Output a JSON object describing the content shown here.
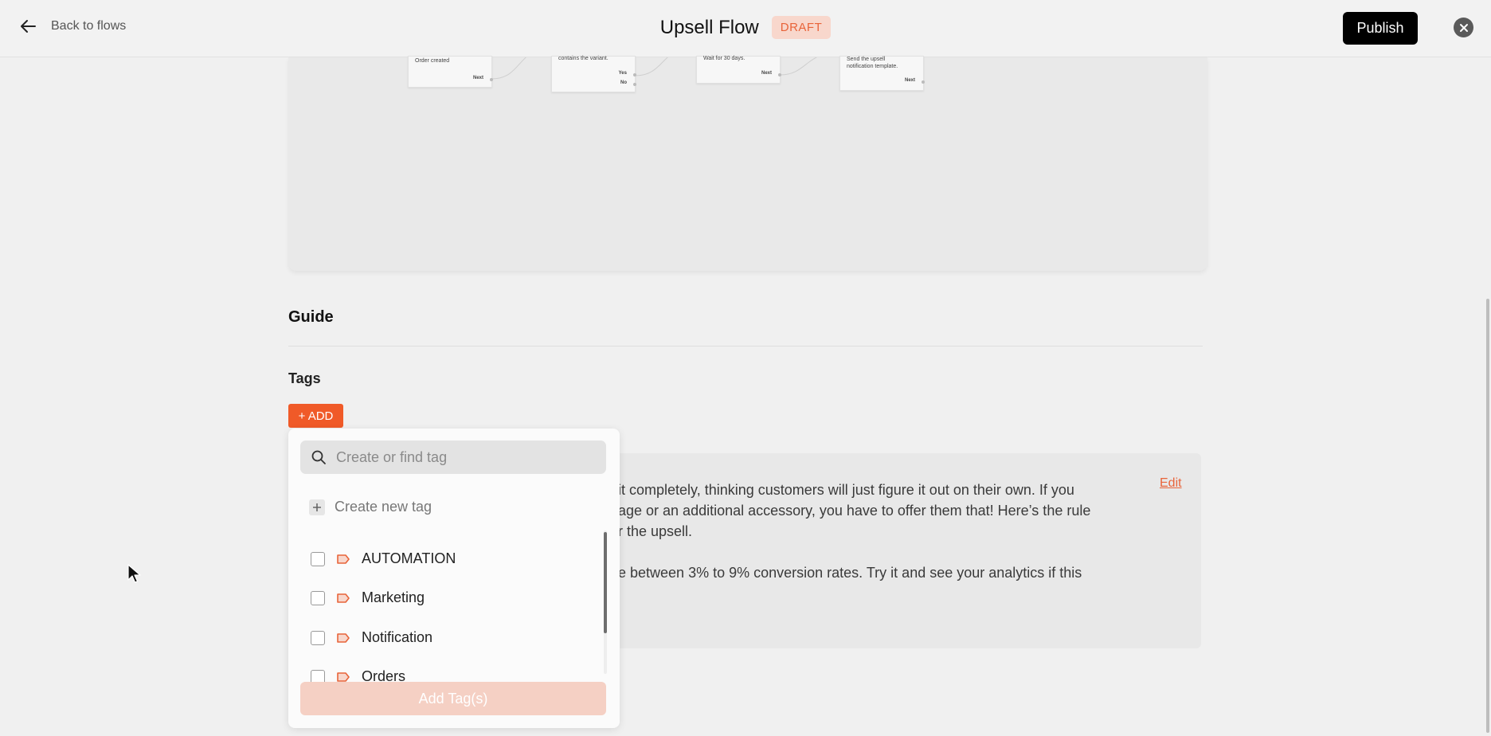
{
  "header": {
    "back_label": "Back to flows",
    "title": "Upsell Flow",
    "status_badge": "DRAFT",
    "publish_label": "Publish"
  },
  "flow_preview": {
    "nodes": [
      {
        "text": "Order created",
        "ports": [
          "Next"
        ]
      },
      {
        "text": "contains the variant.",
        "ports": [
          "Yes",
          "No"
        ]
      },
      {
        "text": "Wait for 30 days.",
        "ports": [
          "Next"
        ]
      },
      {
        "text": "Send the upsell notification template.",
        "ports": [
          "Next"
        ]
      }
    ]
  },
  "guide": {
    "heading": "Guide",
    "edit_label": "Edit",
    "lines": [
      "it completely, thinking customers will just figure it out on their own. If you",
      "age or an additional accessory, you have to offer them that! Here’s the rule",
      "r the upsell.",
      "e between 3% to 9% conversion rates. Try it and see your analytics if this"
    ]
  },
  "tags": {
    "heading": "Tags",
    "add_label": "+ ADD",
    "dropdown": {
      "search_placeholder": "Create or find tag",
      "create_label": "Create new tag",
      "items": [
        "AUTOMATION",
        "Marketing",
        "Notification",
        "Orders"
      ],
      "submit_label": "Add Tag(s)"
    }
  },
  "colors": {
    "accent": "#f05a28",
    "badge_bg": "#f8d7cc",
    "badge_text": "#e8643a",
    "publish_bg": "#000000"
  }
}
